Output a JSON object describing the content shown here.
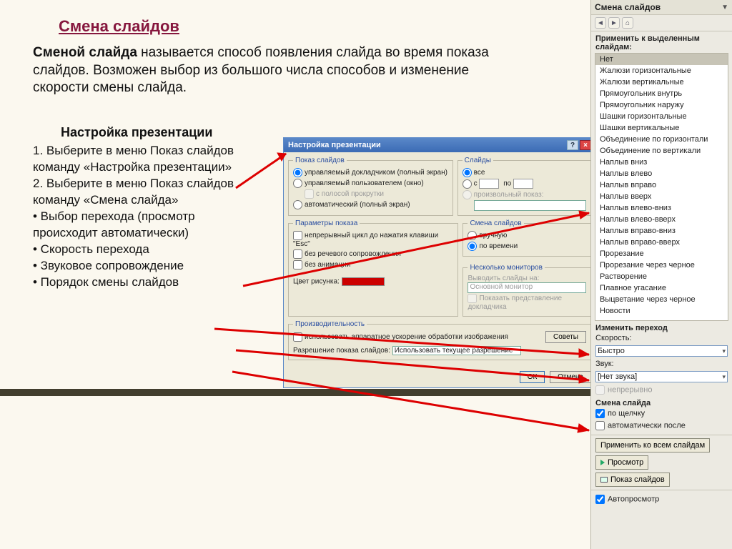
{
  "slide": {
    "title": "Смена слайдов",
    "intro_bold": "Сменой слайда",
    "intro_rest": " называется способ появления слайда во время показа слайдов. Возможен выбор из большого числа способов и изменение скорости смены слайда.",
    "sub_title": "Настройка презентации",
    "steps": [
      "1. Выберите в меню Показ слайдов команду «Настройка презентации»",
      "2. Выберите в меню Показ слайдов команду «Смена слайда»",
      "• Выбор перехода (просмотр происходит автоматически)",
      "• Скорость перехода",
      "• Звуковое сопровождение",
      "• Порядок смены слайдов"
    ]
  },
  "dialog": {
    "title": "Настройка презентации",
    "groups": {
      "show": {
        "legend": "Показ слайдов",
        "r1": "управляемый докладчиком (полный экран)",
        "r2": "управляемый пользователем (окно)",
        "r2a": "с полосой прокрутки",
        "r3": "автоматический (полный экран)"
      },
      "slides": {
        "legend": "Слайды",
        "r1": "все",
        "r2a": "с",
        "r2b": "по",
        "r3": "произвольный показ:"
      },
      "params": {
        "legend": "Параметры показа",
        "c1": "непрерывный цикл до нажатия клавиши \"Esc\"",
        "c2": "без речевого сопровождения",
        "c3": "без анимации",
        "color_label": "Цвет рисунка:"
      },
      "change": {
        "legend": "Смена слайдов",
        "r1": "вручную",
        "r2": "по времени"
      },
      "monitors": {
        "legend": "Несколько мониторов",
        "l1": "Выводить слайды на:",
        "sel": "Основной монитор",
        "c1": "Показать представление докладчика"
      },
      "perf": {
        "legend": "Производительность",
        "c1": "использовать аппаратное ускорение обработки изображения",
        "res_label": "Разрешение показа слайдов:",
        "res_val": "Использовать текущее разрешение",
        "tips": "Советы"
      }
    },
    "ok": "ОК",
    "cancel": "Отмена"
  },
  "panel": {
    "title": "Смена слайдов",
    "apply_label": "Применить к выделенным слайдам:",
    "transitions": [
      "Нет",
      "Жалюзи горизонтальные",
      "Жалюзи вертикальные",
      "Прямоугольник внутрь",
      "Прямоугольник наружу",
      "Шашки горизонтальные",
      "Шашки вертикальные",
      "Объединение по горизонтали",
      "Объединение по вертикали",
      "Наплыв вниз",
      "Наплыв влево",
      "Наплыв вправо",
      "Наплыв вверх",
      "Наплыв влево-вниз",
      "Наплыв влево-вверх",
      "Наплыв вправо-вниз",
      "Наплыв вправо-вверх",
      "Прорезание",
      "Прорезание через черное",
      "Растворение",
      "Плавное угасание",
      "Выцветание через черное",
      "Новости"
    ],
    "modify_label": "Изменить переход",
    "speed_label": "Скорость:",
    "speed_val": "Быстро",
    "sound_label": "Звук:",
    "sound_val": "[Нет звука]",
    "loop": "непрерывно",
    "advance_label": "Смена слайда",
    "on_click": "по щелчку",
    "auto_after": "автоматически после",
    "apply_all": "Применить ко всем слайдам",
    "preview": "Просмотр",
    "slideshow": "Показ слайдов",
    "autoprev": "Автопросмотр"
  }
}
